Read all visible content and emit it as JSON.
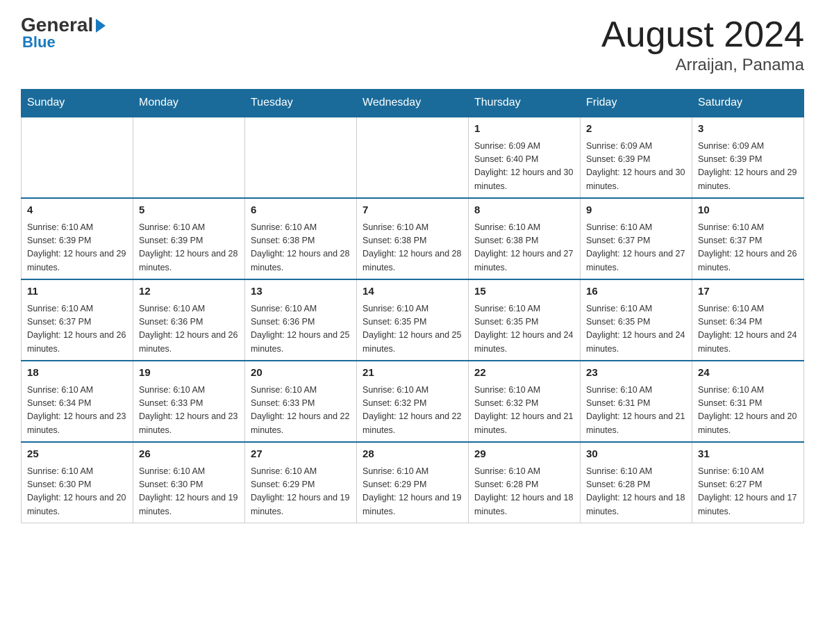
{
  "logo": {
    "general": "General",
    "blue": "Blue",
    "tagline": "Blue"
  },
  "header": {
    "title": "August 2024",
    "subtitle": "Arraijan, Panama"
  },
  "weekdays": [
    "Sunday",
    "Monday",
    "Tuesday",
    "Wednesday",
    "Thursday",
    "Friday",
    "Saturday"
  ],
  "weeks": [
    [
      {
        "day": "",
        "info": ""
      },
      {
        "day": "",
        "info": ""
      },
      {
        "day": "",
        "info": ""
      },
      {
        "day": "",
        "info": ""
      },
      {
        "day": "1",
        "info": "Sunrise: 6:09 AM\nSunset: 6:40 PM\nDaylight: 12 hours and 30 minutes."
      },
      {
        "day": "2",
        "info": "Sunrise: 6:09 AM\nSunset: 6:39 PM\nDaylight: 12 hours and 30 minutes."
      },
      {
        "day": "3",
        "info": "Sunrise: 6:09 AM\nSunset: 6:39 PM\nDaylight: 12 hours and 29 minutes."
      }
    ],
    [
      {
        "day": "4",
        "info": "Sunrise: 6:10 AM\nSunset: 6:39 PM\nDaylight: 12 hours and 29 minutes."
      },
      {
        "day": "5",
        "info": "Sunrise: 6:10 AM\nSunset: 6:39 PM\nDaylight: 12 hours and 28 minutes."
      },
      {
        "day": "6",
        "info": "Sunrise: 6:10 AM\nSunset: 6:38 PM\nDaylight: 12 hours and 28 minutes."
      },
      {
        "day": "7",
        "info": "Sunrise: 6:10 AM\nSunset: 6:38 PM\nDaylight: 12 hours and 28 minutes."
      },
      {
        "day": "8",
        "info": "Sunrise: 6:10 AM\nSunset: 6:38 PM\nDaylight: 12 hours and 27 minutes."
      },
      {
        "day": "9",
        "info": "Sunrise: 6:10 AM\nSunset: 6:37 PM\nDaylight: 12 hours and 27 minutes."
      },
      {
        "day": "10",
        "info": "Sunrise: 6:10 AM\nSunset: 6:37 PM\nDaylight: 12 hours and 26 minutes."
      }
    ],
    [
      {
        "day": "11",
        "info": "Sunrise: 6:10 AM\nSunset: 6:37 PM\nDaylight: 12 hours and 26 minutes."
      },
      {
        "day": "12",
        "info": "Sunrise: 6:10 AM\nSunset: 6:36 PM\nDaylight: 12 hours and 26 minutes."
      },
      {
        "day": "13",
        "info": "Sunrise: 6:10 AM\nSunset: 6:36 PM\nDaylight: 12 hours and 25 minutes."
      },
      {
        "day": "14",
        "info": "Sunrise: 6:10 AM\nSunset: 6:35 PM\nDaylight: 12 hours and 25 minutes."
      },
      {
        "day": "15",
        "info": "Sunrise: 6:10 AM\nSunset: 6:35 PM\nDaylight: 12 hours and 24 minutes."
      },
      {
        "day": "16",
        "info": "Sunrise: 6:10 AM\nSunset: 6:35 PM\nDaylight: 12 hours and 24 minutes."
      },
      {
        "day": "17",
        "info": "Sunrise: 6:10 AM\nSunset: 6:34 PM\nDaylight: 12 hours and 24 minutes."
      }
    ],
    [
      {
        "day": "18",
        "info": "Sunrise: 6:10 AM\nSunset: 6:34 PM\nDaylight: 12 hours and 23 minutes."
      },
      {
        "day": "19",
        "info": "Sunrise: 6:10 AM\nSunset: 6:33 PM\nDaylight: 12 hours and 23 minutes."
      },
      {
        "day": "20",
        "info": "Sunrise: 6:10 AM\nSunset: 6:33 PM\nDaylight: 12 hours and 22 minutes."
      },
      {
        "day": "21",
        "info": "Sunrise: 6:10 AM\nSunset: 6:32 PM\nDaylight: 12 hours and 22 minutes."
      },
      {
        "day": "22",
        "info": "Sunrise: 6:10 AM\nSunset: 6:32 PM\nDaylight: 12 hours and 21 minutes."
      },
      {
        "day": "23",
        "info": "Sunrise: 6:10 AM\nSunset: 6:31 PM\nDaylight: 12 hours and 21 minutes."
      },
      {
        "day": "24",
        "info": "Sunrise: 6:10 AM\nSunset: 6:31 PM\nDaylight: 12 hours and 20 minutes."
      }
    ],
    [
      {
        "day": "25",
        "info": "Sunrise: 6:10 AM\nSunset: 6:30 PM\nDaylight: 12 hours and 20 minutes."
      },
      {
        "day": "26",
        "info": "Sunrise: 6:10 AM\nSunset: 6:30 PM\nDaylight: 12 hours and 19 minutes."
      },
      {
        "day": "27",
        "info": "Sunrise: 6:10 AM\nSunset: 6:29 PM\nDaylight: 12 hours and 19 minutes."
      },
      {
        "day": "28",
        "info": "Sunrise: 6:10 AM\nSunset: 6:29 PM\nDaylight: 12 hours and 19 minutes."
      },
      {
        "day": "29",
        "info": "Sunrise: 6:10 AM\nSunset: 6:28 PM\nDaylight: 12 hours and 18 minutes."
      },
      {
        "day": "30",
        "info": "Sunrise: 6:10 AM\nSunset: 6:28 PM\nDaylight: 12 hours and 18 minutes."
      },
      {
        "day": "31",
        "info": "Sunrise: 6:10 AM\nSunset: 6:27 PM\nDaylight: 12 hours and 17 minutes."
      }
    ]
  ]
}
